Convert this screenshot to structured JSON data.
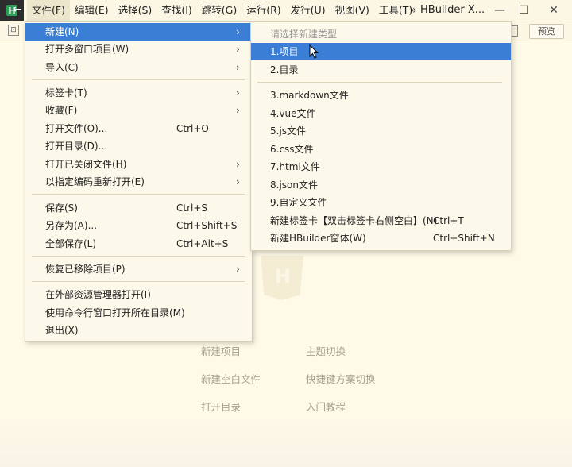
{
  "titlebar": {
    "app_title": "HBuilder X...",
    "chevron": "»",
    "menus": [
      "文件(F)",
      "编辑(E)",
      "选择(S)",
      "查找(I)",
      "跳转(G)",
      "运行(R)",
      "发行(U)",
      "视图(V)",
      "工具(T)"
    ],
    "minimize": "—",
    "maximize": "☐",
    "close": "✕"
  },
  "toolbar": {
    "preview_label": "预览"
  },
  "file_menu": {
    "items": [
      {
        "label": "新建(N)",
        "arrow": "›"
      },
      {
        "label": "打开多窗口项目(W)",
        "arrow": "›"
      },
      {
        "label": "导入(C)",
        "arrow": "›"
      },
      {
        "label": "标签卡(T)",
        "arrow": "›"
      },
      {
        "label": "收藏(F)",
        "arrow": "›"
      },
      {
        "label": "打开文件(O)...",
        "shortcut": "Ctrl+O"
      },
      {
        "label": "打开目录(D)..."
      },
      {
        "label": "打开已关闭文件(H)",
        "arrow": "›"
      },
      {
        "label": "以指定编码重新打开(E)",
        "arrow": "›"
      },
      {
        "label": "保存(S)",
        "shortcut": "Ctrl+S"
      },
      {
        "label": "另存为(A)...",
        "shortcut": "Ctrl+Shift+S"
      },
      {
        "label": "全部保存(L)",
        "shortcut": "Ctrl+Alt+S"
      },
      {
        "label": "恢复已移除项目(P)",
        "arrow": "›"
      },
      {
        "label": "在外部资源管理器打开(I)"
      },
      {
        "label": "使用命令行窗口打开所在目录(M)"
      },
      {
        "label": "退出(X)"
      }
    ]
  },
  "new_submenu": {
    "hint": "请选择新建类型",
    "items": [
      {
        "label": "1.项目"
      },
      {
        "label": "2.目录"
      },
      {
        "label": "3.markdown文件"
      },
      {
        "label": "4.vue文件"
      },
      {
        "label": "5.js文件"
      },
      {
        "label": "6.css文件"
      },
      {
        "label": "7.html文件"
      },
      {
        "label": "8.json文件"
      },
      {
        "label": "9.自定义文件"
      },
      {
        "label": "新建标签卡【双击标签卡右侧空白】(N)",
        "shortcut": "Ctrl+T"
      },
      {
        "label": "新建HBuilder窗体(W)",
        "shortcut": "Ctrl+Shift+N"
      }
    ]
  },
  "welcome": {
    "links": [
      "新建项目",
      "主题切换",
      "新建空白文件",
      "快捷键方案切换",
      "打开目录",
      "入门教程"
    ]
  },
  "colors": {
    "highlight": "#3a7fd5",
    "background": "#fffae8"
  }
}
